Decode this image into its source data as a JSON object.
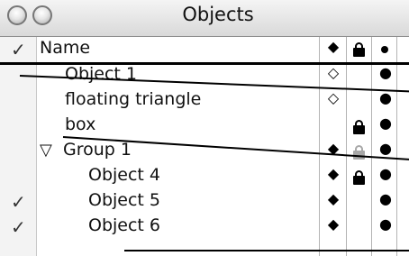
{
  "window": {
    "title": "Objects"
  },
  "header": {
    "check": "✓",
    "name_label": "Name",
    "visible_icon": "◆",
    "lock_icon": "lock-icon",
    "dot_icon": "●"
  },
  "rows": [
    {
      "check": "",
      "name": "Object 1",
      "visible": "◇",
      "locked": false,
      "locked_dim": false,
      "dot": "●"
    },
    {
      "check": "",
      "name": "floating triangle",
      "visible": "◇",
      "locked": false,
      "locked_dim": false,
      "dot": "●"
    },
    {
      "check": "",
      "name": "box",
      "visible": "",
      "locked": true,
      "locked_dim": false,
      "dot": "●"
    },
    {
      "check": "",
      "name": "Group 1",
      "disclosure": "▽",
      "visible": "◆",
      "locked": true,
      "locked_dim": true,
      "dot": "●"
    },
    {
      "check": "",
      "name": "Object 4",
      "visible": "◆",
      "locked": true,
      "locked_dim": false,
      "dot": "●"
    },
    {
      "check": "✓",
      "name": "Object 5",
      "visible": "◆",
      "locked": false,
      "locked_dim": false,
      "dot": "●"
    },
    {
      "check": "✓",
      "name": "Object 6",
      "visible": "◆",
      "locked": false,
      "locked_dim": false,
      "dot": "●"
    }
  ],
  "colors": {
    "titlebar_top": "#f4f4f4",
    "titlebar_bottom": "#d9d9d9",
    "text": "#111111",
    "column_separator": "#b3b3b3"
  }
}
